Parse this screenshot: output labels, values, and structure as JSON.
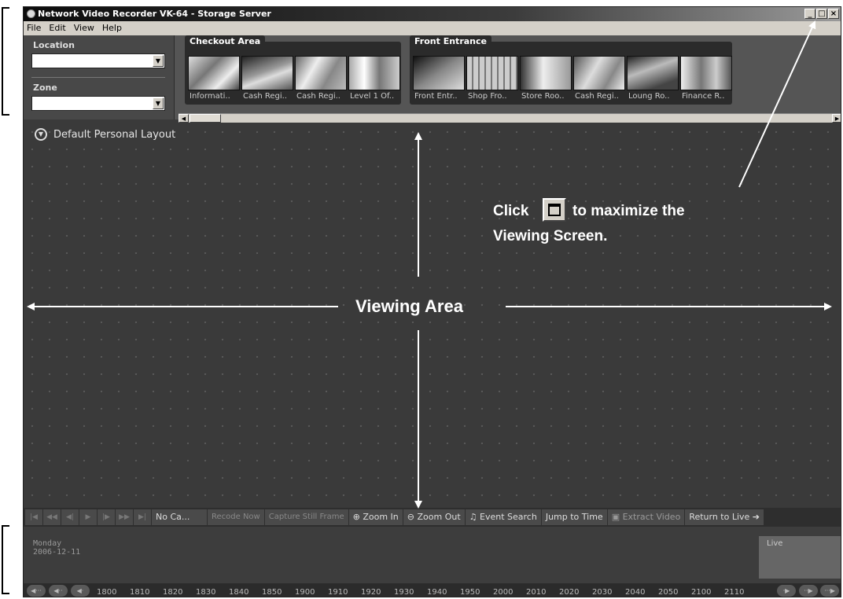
{
  "window": {
    "title": "Network Video Recorder VK-64 - Storage Server",
    "buttons": {
      "minimize": "_",
      "maximize": "□",
      "close": "×"
    }
  },
  "menu": [
    "File",
    "Edit",
    "View",
    "Help"
  ],
  "filters": {
    "location_label": "Location",
    "location_value": "",
    "zone_label": "Zone",
    "zone_value": ""
  },
  "camera_groups": [
    {
      "name": "Checkout Area",
      "cameras": [
        "Informati..",
        "Cash Regi..",
        "Cash Regi..",
        "Level 1 Of.."
      ]
    },
    {
      "name": "Front Entrance",
      "cameras": [
        "Front Entr..",
        "Shop Fro..",
        "Store Roo..",
        "Cash Regi..",
        "Loung Ro..",
        "Finance R.."
      ]
    }
  ],
  "layout": {
    "title": "Default Personal Layout"
  },
  "toolbar": {
    "camera_name": "No Ca...",
    "record_now": "Recode Now",
    "capture_still": "Capture Still Frame",
    "zoom_in": "Zoom In",
    "zoom_out": "Zoom Out",
    "event_search": "Event Search",
    "jump_to_time": "Jump to Time",
    "extract_video": "Extract Video",
    "return_to_live": "Return to Live"
  },
  "timeline": {
    "day": "Monday",
    "date": "2006-12-11",
    "live_label": "Live",
    "ticks": [
      "1800",
      "1810",
      "1820",
      "1830",
      "1840",
      "1850",
      "1900",
      "1910",
      "1920",
      "1930",
      "1940",
      "1950",
      "2000",
      "2010",
      "2020",
      "2030",
      "2040",
      "2050",
      "2100",
      "2110"
    ]
  },
  "annotations": {
    "click_word": "Click",
    "maximize_rest": "to maximize the",
    "maximize_line2": "Viewing Screen.",
    "viewing_area": "Viewing Area"
  },
  "icons": {
    "app": "camera-icon",
    "layout_toggle": "chevron-down-circle-icon",
    "zoom_in": "magnifier-plus-icon",
    "zoom_out": "magnifier-minus-icon",
    "event_search": "bell-icon",
    "extract_video": "floppy-disk-icon",
    "return_to_live": "arrow-right-icon"
  },
  "colors": {
    "background": "#3a3a3a",
    "panel": "#555555",
    "chrome": "#d4d0c8",
    "annotation": "#ffffff"
  }
}
